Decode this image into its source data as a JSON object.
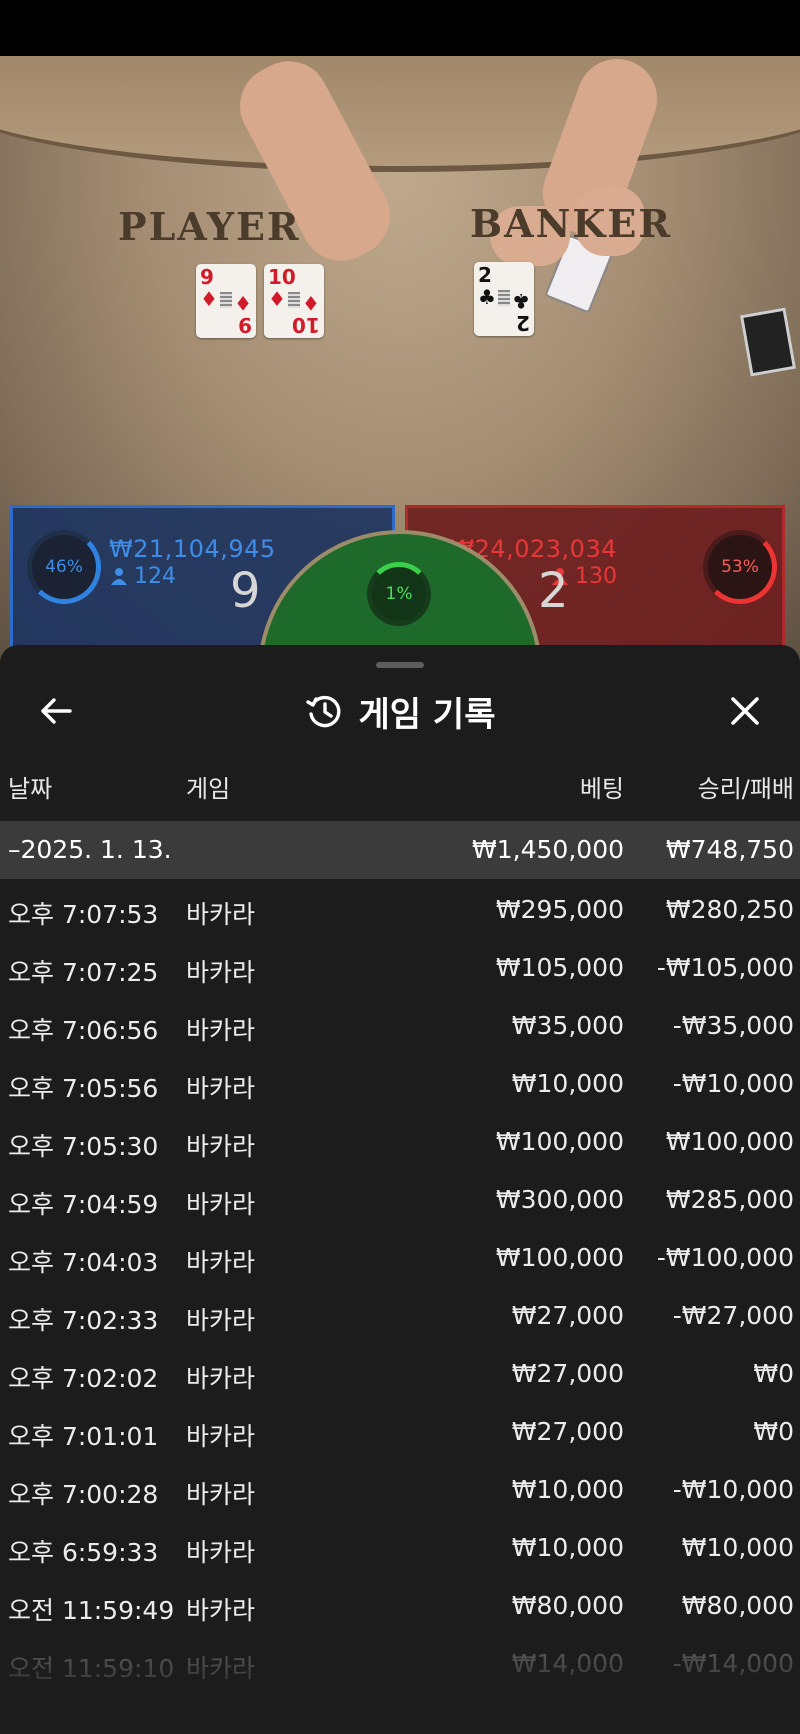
{
  "scene": {
    "player_label": "PLAYER",
    "banker_label": "BANKER",
    "player_cards": [
      {
        "rank": "9",
        "suit": "♦",
        "color": "#d11b2a"
      },
      {
        "rank": "10",
        "suit": "♦",
        "color": "#d11b2a"
      }
    ],
    "banker_cards": [
      {
        "rank": "2",
        "suit": "♣",
        "color": "#111111"
      }
    ]
  },
  "bets": {
    "player": {
      "percent": "46%",
      "amount": "₩21,104,945",
      "players": "124",
      "score": "9",
      "color": "#3e8de8"
    },
    "banker": {
      "percent": "53%",
      "amount": "₩24,023,034",
      "players": "130",
      "score": "2",
      "color": "#e63838"
    },
    "tie": {
      "percent": "1%",
      "color": "#46e05a"
    }
  },
  "history": {
    "title": "게임 기록",
    "columns": {
      "date": "날짜",
      "game": "게임",
      "bet": "베팅",
      "winloss": "승리/패배"
    },
    "day": {
      "label": "–2025. 1. 13.",
      "bet": "₩1,450,000",
      "winloss": "₩748,750"
    },
    "rows": [
      {
        "time": "오후 7:07:53",
        "game": "바카라",
        "bet": "₩295,000",
        "winloss": "₩280,250"
      },
      {
        "time": "오후 7:07:25",
        "game": "바카라",
        "bet": "₩105,000",
        "winloss": "-₩105,000"
      },
      {
        "time": "오후 7:06:56",
        "game": "바카라",
        "bet": "₩35,000",
        "winloss": "-₩35,000"
      },
      {
        "time": "오후 7:05:56",
        "game": "바카라",
        "bet": "₩10,000",
        "winloss": "-₩10,000"
      },
      {
        "time": "오후 7:05:30",
        "game": "바카라",
        "bet": "₩100,000",
        "winloss": "₩100,000"
      },
      {
        "time": "오후 7:04:59",
        "game": "바카라",
        "bet": "₩300,000",
        "winloss": "₩285,000"
      },
      {
        "time": "오후 7:04:03",
        "game": "바카라",
        "bet": "₩100,000",
        "winloss": "-₩100,000"
      },
      {
        "time": "오후 7:02:33",
        "game": "바카라",
        "bet": "₩27,000",
        "winloss": "-₩27,000"
      },
      {
        "time": "오후 7:02:02",
        "game": "바카라",
        "bet": "₩27,000",
        "winloss": "₩0"
      },
      {
        "time": "오후 7:01:01",
        "game": "바카라",
        "bet": "₩27,000",
        "winloss": "₩0"
      },
      {
        "time": "오후 7:00:28",
        "game": "바카라",
        "bet": "₩10,000",
        "winloss": "-₩10,000"
      },
      {
        "time": "오후 6:59:33",
        "game": "바카라",
        "bet": "₩10,000",
        "winloss": "₩10,000"
      },
      {
        "time": "오전 11:59:49",
        "game": "바카라",
        "bet": "₩80,000",
        "winloss": "₩80,000"
      },
      {
        "time": "오전 11:59:10",
        "game": "바카라",
        "bet": "₩14,000",
        "winloss": "-₩14,000"
      }
    ]
  },
  "icons": {
    "back": "arrow-left-icon",
    "history": "history-icon",
    "close": "close-icon",
    "person": "person-icon"
  }
}
